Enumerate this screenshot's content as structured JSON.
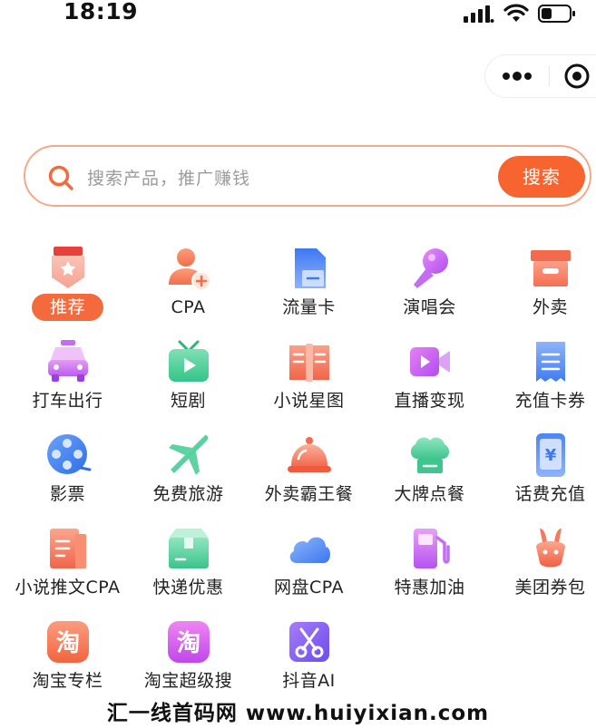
{
  "status_bar": {
    "time": "18:19"
  },
  "search": {
    "placeholder": "搜索产品，推广赚钱",
    "button_label": "搜索"
  },
  "grid": {
    "items": [
      {
        "label": "推荐",
        "icon": "recommend-badge-icon"
      },
      {
        "label": "CPA",
        "icon": "user-add-icon"
      },
      {
        "label": "流量卡",
        "icon": "sim-card-icon"
      },
      {
        "label": "演唱会",
        "icon": "microphone-icon"
      },
      {
        "label": "外卖",
        "icon": "takeout-box-icon"
      },
      {
        "label": "打车出行",
        "icon": "taxi-icon"
      },
      {
        "label": "短剧",
        "icon": "tv-play-icon"
      },
      {
        "label": "小说星图",
        "icon": "open-book-icon"
      },
      {
        "label": "直播变现",
        "icon": "video-camera-icon"
      },
      {
        "label": "充值卡券",
        "icon": "receipt-icon"
      },
      {
        "label": "影票",
        "icon": "film-reel-icon"
      },
      {
        "label": "免费旅游",
        "icon": "airplane-icon"
      },
      {
        "label": "外卖霸王餐",
        "icon": "food-cloche-icon"
      },
      {
        "label": "大牌点餐",
        "icon": "chef-hat-icon"
      },
      {
        "label": "话费充值",
        "icon": "phone-yuan-icon"
      },
      {
        "label": "小说推文CPA",
        "icon": "novel-chart-icon"
      },
      {
        "label": "快递优惠",
        "icon": "parcel-box-icon"
      },
      {
        "label": "网盘CPA",
        "icon": "cloud-icon"
      },
      {
        "label": "特惠加油",
        "icon": "fuel-pump-icon"
      },
      {
        "label": "美团券包",
        "icon": "kangaroo-icon"
      },
      {
        "label": "淘宝专栏",
        "icon": "taobao-icon"
      },
      {
        "label": "淘宝超级搜",
        "icon": "taobao-super-icon"
      },
      {
        "label": "抖音AI",
        "icon": "scissors-icon"
      }
    ]
  },
  "watermark": {
    "text": "汇一线首码网 www.huiyixian.com"
  },
  "colors": {
    "accent": "#f7642f",
    "search_border": "#f5a98a"
  }
}
